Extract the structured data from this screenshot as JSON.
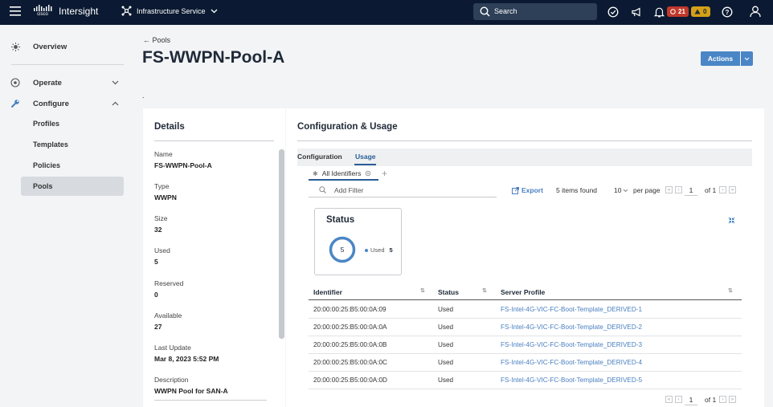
{
  "topbar": {
    "brand": "Intersight",
    "cisco": "cisco",
    "service": "Infrastructure Service",
    "search_placeholder": "Search",
    "alerts_red": "21",
    "alerts_yellow": "0"
  },
  "sidebar": {
    "overview": "Overview",
    "operate": "Operate",
    "configure": "Configure",
    "sub": [
      "Profiles",
      "Templates",
      "Policies",
      "Pools"
    ]
  },
  "page": {
    "breadcrumb": "← Pools",
    "title": "FS-WWPN-Pool-A",
    "actions": "Actions",
    "stray": "."
  },
  "details": {
    "heading": "Details",
    "fields": [
      {
        "label": "Name",
        "value": "FS-WWPN-Pool-A"
      },
      {
        "label": "Type",
        "value": "WWPN"
      },
      {
        "label": "Size",
        "value": "32"
      },
      {
        "label": "Used",
        "value": "5"
      },
      {
        "label": "Reserved",
        "value": "0"
      },
      {
        "label": "Available",
        "value": "27"
      },
      {
        "label": "Last Update",
        "value": "Mar 8, 2023 5:52 PM"
      },
      {
        "label": "Description",
        "value": "WWPN Pool for SAN-A"
      }
    ]
  },
  "config": {
    "heading": "Configuration & Usage",
    "tabs": [
      "Configuration",
      "Usage"
    ],
    "subtab": "All Identifiers",
    "filter_placeholder": "Add Filter",
    "export": "Export",
    "items_found": "5 items found",
    "per_page_value": "10",
    "per_page_label": "per page",
    "page_current": "1",
    "page_total": "of 1",
    "status_card": {
      "title": "Status",
      "total": "5",
      "legend_label": "Used",
      "legend_value": "5"
    },
    "columns": [
      "Identifier",
      "Status",
      "Server Profile"
    ],
    "rows": [
      {
        "identifier": "20:00:00:25:B5:00:0A:09",
        "status": "Used",
        "profile": "FS-Intel-4G-VIC-FC-Boot-Template_DERIVED-1"
      },
      {
        "identifier": "20:00:00:25:B5:00:0A:0A",
        "status": "Used",
        "profile": "FS-Intel-4G-VIC-FC-Boot-Template_DERIVED-2"
      },
      {
        "identifier": "20:00:00:25:B5:00:0A:0B",
        "status": "Used",
        "profile": "FS-Intel-4G-VIC-FC-Boot-Template_DERIVED-3"
      },
      {
        "identifier": "20:00:00:25:B5:00:0A:0C",
        "status": "Used",
        "profile": "FS-Intel-4G-VIC-FC-Boot-Template_DERIVED-4"
      },
      {
        "identifier": "20:00:00:25:B5:00:0A:0D",
        "status": "Used",
        "profile": "FS-Intel-4G-VIC-FC-Boot-Template_DERIVED-5"
      }
    ],
    "footer_page_current": "1",
    "footer_page_total": "of 1"
  },
  "colors": {
    "topbar": "#0b1a32",
    "accent": "#4a86c6",
    "link": "#4a7fc0",
    "red_badge": "#c0392b",
    "yellow_badge": "#d4a017"
  }
}
